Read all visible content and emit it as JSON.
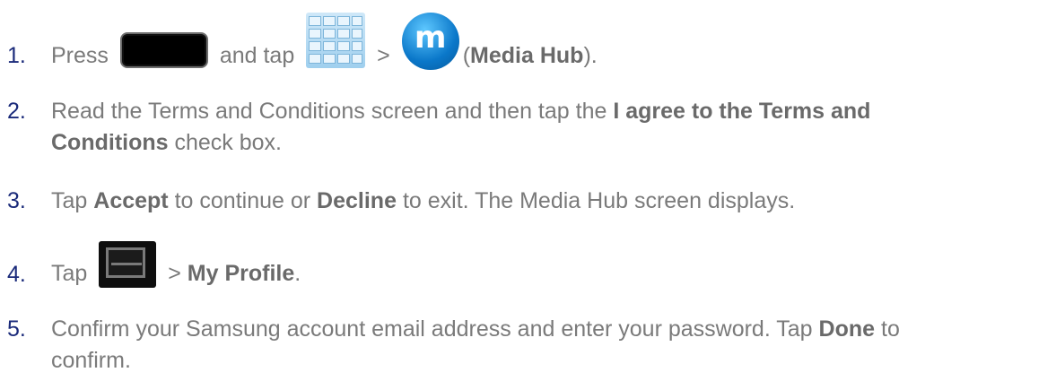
{
  "steps": [
    {
      "number": "1.",
      "parts": {
        "press": "Press",
        "and_tap": "and tap",
        "gt": ">",
        "paren_open": "(",
        "app": "Media Hub",
        "paren_close": ")."
      },
      "icons": [
        "home-key-icon",
        "applications-icon",
        "media-hub-icon"
      ]
    },
    {
      "number": "2.",
      "parts": {
        "a": "Read the Terms and Conditions screen and then tap the",
        "b1": "I agree to the Terms and",
        "b2": "Conditions",
        "c": "check box."
      }
    },
    {
      "number": "3.",
      "parts": {
        "tap": "Tap",
        "accept": "Accept",
        "mid": "to continue or",
        "decline": "Decline",
        "end": "to exit. The Media Hub screen displays."
      }
    },
    {
      "number": "4.",
      "parts": {
        "tap": "Tap",
        "gt": ">",
        "profile": "My Profile",
        "period": "."
      },
      "icons": [
        "menu-key-icon"
      ]
    },
    {
      "number": "5.",
      "parts": {
        "a": "Confirm your Samsung account email address and enter your password. Tap",
        "done": "Done",
        "to": "to",
        "b": "confirm."
      }
    }
  ],
  "colors": {
    "text": "#7a7a7a",
    "number": "#1a2a7a",
    "bold": "#6a6a6a"
  }
}
